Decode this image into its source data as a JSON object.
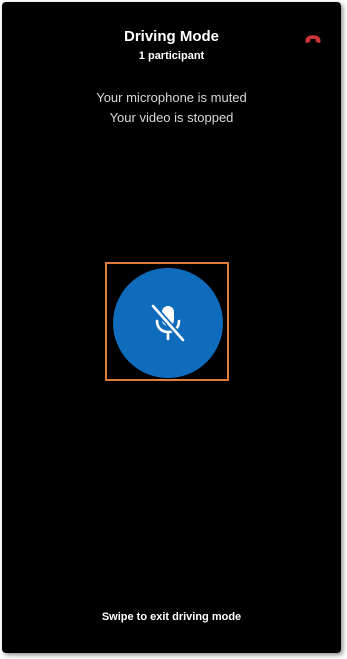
{
  "header": {
    "title": "Driving Mode",
    "participants": "1 participant",
    "hangup_icon": "hang-up-phone-icon",
    "hangup_color": "#d13438"
  },
  "status": {
    "microphone": "Your microphone is muted",
    "video": "Your video is stopped"
  },
  "mute_toggle": {
    "icon": "microphone-off-icon",
    "state": "muted",
    "color": "#0f6cbd",
    "highlight_color": "#e07b39"
  },
  "footer": {
    "swipe_text": "Swipe to exit driving mode"
  }
}
